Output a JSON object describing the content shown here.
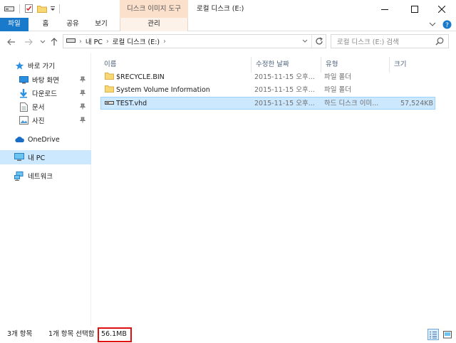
{
  "window": {
    "title": "로컬 디스크 (E:)",
    "context_tab_group": "디스크 이미지 도구"
  },
  "ribbon": {
    "tabs": [
      "파일",
      "홈",
      "공유",
      "보기"
    ],
    "context_tab": "관리"
  },
  "address": {
    "path": [
      "내 PC",
      "로컬 디스크 (E:)"
    ],
    "search_placeholder": "로컬 디스크 (E:) 검색"
  },
  "nav": {
    "quick_access": "바로 가기",
    "pinned": [
      {
        "label": "바탕 화면",
        "icon": "desktop-icon"
      },
      {
        "label": "다운로드",
        "icon": "download-icon"
      },
      {
        "label": "문서",
        "icon": "document-icon"
      },
      {
        "label": "사진",
        "icon": "pictures-icon"
      }
    ],
    "onedrive": "OneDrive",
    "this_pc": "내 PC",
    "network": "네트워크"
  },
  "columns": {
    "name": "이름",
    "modified": "수정한 날짜",
    "type": "유형",
    "size": "크기"
  },
  "files": [
    {
      "name": "$RECYCLE.BIN",
      "modified": "2015-11-15 오후...",
      "type": "파일 폴더",
      "size": "",
      "icon": "folder-icon"
    },
    {
      "name": "System Volume Information",
      "modified": "2015-11-15 오후...",
      "type": "파일 폴더",
      "size": "",
      "icon": "folder-icon"
    },
    {
      "name": "TEST.vhd",
      "modified": "2015-11-15 오후...",
      "type": "하드 디스크 이미...",
      "size": "57,524KB",
      "icon": "disk-image-icon"
    }
  ],
  "status": {
    "item_count": "3개 항목",
    "selected": "1개 항목 선택함",
    "selected_size": "56.1MB"
  },
  "colors": {
    "file_tab": "#1979ca",
    "context_tab": "#fbe0cc",
    "selection": "#cce8ff",
    "highlight_box": "#e01010"
  }
}
